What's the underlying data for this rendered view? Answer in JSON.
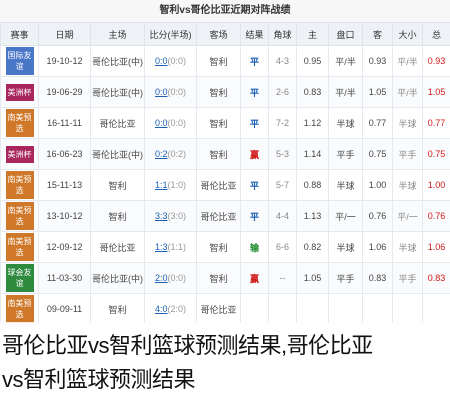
{
  "page": {
    "title": "智利vs哥伦比亚近期对阵战绩"
  },
  "columns": [
    "赛事",
    "日期",
    "主场",
    "比分(半场)",
    "客场",
    "结果",
    "角球",
    "主",
    "盘口",
    "客",
    "大小",
    "总"
  ],
  "rows": [
    {
      "league": "国际友谊",
      "league_color": "#4a76c8",
      "date": "19-10-12",
      "home": "哥伦比亚(中)",
      "score": "0:0",
      "half": "(0:0)",
      "away": "智利",
      "result": "平",
      "result_color": "#1a5fb4",
      "corner": "4-3",
      "h": "0.95",
      "line": "平/半",
      "a": "0.93"
    },
    {
      "league": "美洲杯",
      "league_color": "#a8285e",
      "date": "19-06-29",
      "home": "哥伦比亚(中)",
      "score": "0:0",
      "half": "(0:0)",
      "away": "智利",
      "result": "平",
      "result_color": "#1a5fb4",
      "corner": "2-6",
      "h": "0.83",
      "line": "平/半",
      "a": "1.05"
    },
    {
      "league": "南美预选",
      "league_color": "#d0782a",
      "date": "16-11-11",
      "home": "哥伦比亚",
      "score": "0:0",
      "half": "(0:0)",
      "away": "智利",
      "result": "平",
      "result_color": "#1a5fb4",
      "corner": "7-2",
      "h": "1.12",
      "line": "半球",
      "a": "0.77"
    },
    {
      "league": "美洲杯",
      "league_color": "#a8285e",
      "date": "16-06-23",
      "home": "哥伦比亚(中)",
      "score": "0:2",
      "half": "(0:2)",
      "away": "智利",
      "result": "赢",
      "result_color": "#d01818",
      "corner": "5-3",
      "h": "1.14",
      "line": "平手",
      "a": "0.75"
    },
    {
      "league": "南美预选",
      "league_color": "#d0782a",
      "date": "15-11-13",
      "home": "智利",
      "score": "1:1",
      "half": "(1:0)",
      "away": "哥伦比亚",
      "result": "平",
      "result_color": "#1a5fb4",
      "corner": "5-7",
      "h": "0.88",
      "line": "半球",
      "a": "1.00"
    },
    {
      "league": "南美预选",
      "league_color": "#d0782a",
      "date": "13-10-12",
      "home": "智利",
      "score": "3:3",
      "half": "(3:0)",
      "away": "哥伦比亚",
      "result": "平",
      "result_color": "#1a5fb4",
      "corner": "4-4",
      "h": "1.13",
      "line": "平/一",
      "a": "0.76"
    },
    {
      "league": "南美预选",
      "league_color": "#d0782a",
      "date": "12-09-12",
      "home": "哥伦比亚",
      "score": "1:3",
      "half": "(1:1)",
      "away": "智利",
      "result": "输",
      "result_color": "#1e8a2e",
      "corner": "6-6",
      "h": "0.82",
      "line": "半球",
      "a": "1.06"
    },
    {
      "league": "球会友谊",
      "league_color": "#2e8a3e",
      "date": "11-03-30",
      "home": "哥伦比亚(中)",
      "score": "2:0",
      "half": "(0:0)",
      "away": "智利",
      "result": "赢",
      "result_color": "#d01818",
      "corner": "--",
      "h": "1.05",
      "line": "平手",
      "a": "0.83"
    },
    {
      "league": "南美预选",
      "league_color": "#d0782a",
      "date": "09-09-11",
      "home": "智利",
      "score": "4:0",
      "half": "(2:0)",
      "away": "哥伦比亚",
      "result": "",
      "result_color": "#888888",
      "corner": "",
      "h": "",
      "line": "",
      "a": ""
    }
  ],
  "overlay": {
    "line1": "哥伦比亚vs智利篮球预测结果,哥伦比亚",
    "line2": "vs智利篮球预测结果"
  }
}
